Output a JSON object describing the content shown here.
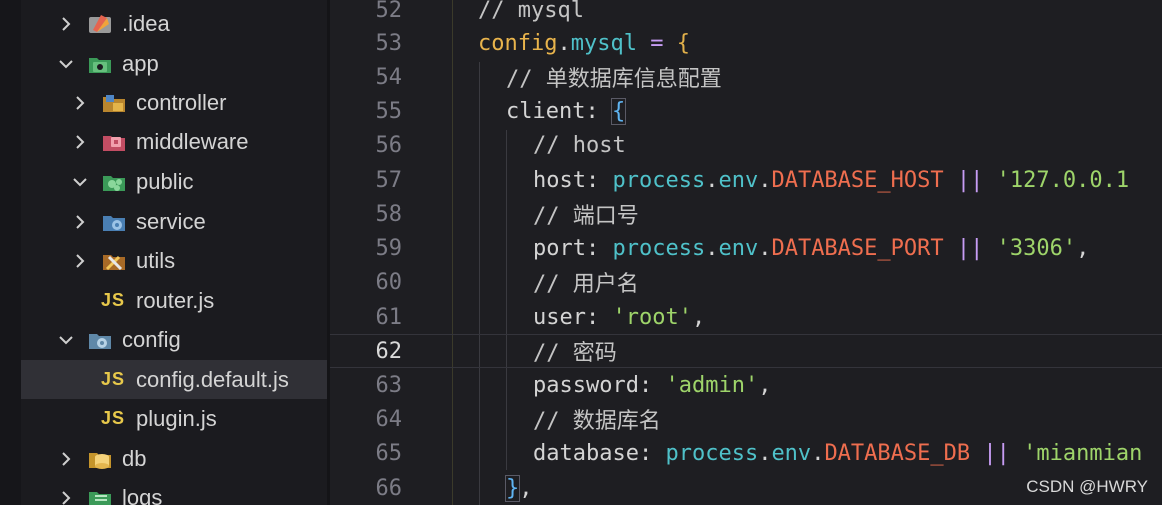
{
  "explorer": {
    "items": [
      {
        "label": ".idea",
        "chevron": "right",
        "icon": "idea-folder-icon",
        "depth": 0
      },
      {
        "label": "app",
        "chevron": "down",
        "icon": "app-folder-icon",
        "depth": 0
      },
      {
        "label": "controller",
        "chevron": "right",
        "icon": "controller-folder-icon",
        "depth": 1
      },
      {
        "label": "middleware",
        "chevron": "right",
        "icon": "middleware-folder-icon",
        "depth": 1
      },
      {
        "label": "public",
        "chevron": "down",
        "icon": "public-folder-icon",
        "depth": 1
      },
      {
        "label": "service",
        "chevron": "right",
        "icon": "service-folder-icon",
        "depth": 1
      },
      {
        "label": "utils",
        "chevron": "right",
        "icon": "utils-folder-icon",
        "depth": 1
      },
      {
        "label": "router.js",
        "chevron": "none",
        "icon": "js-file-icon",
        "depth": 1
      },
      {
        "label": "config",
        "chevron": "down",
        "icon": "config-folder-icon",
        "depth": 0
      },
      {
        "label": "config.default.js",
        "chevron": "none",
        "icon": "js-file-icon",
        "depth": 1,
        "selected": true
      },
      {
        "label": "plugin.js",
        "chevron": "none",
        "icon": "js-file-icon",
        "depth": 1
      },
      {
        "label": "db",
        "chevron": "right",
        "icon": "db-folder-icon",
        "depth": 0
      },
      {
        "label": "logs",
        "chevron": "right",
        "icon": "logs-folder-icon",
        "depth": 0
      }
    ],
    "js_badge": "JS"
  },
  "editor": {
    "active_line": "62",
    "lines": [
      {
        "n": "52",
        "text": "// mysql"
      },
      {
        "n": "53",
        "text": "config.mysql = {"
      },
      {
        "n": "54",
        "text": "// 单数据库信息配置"
      },
      {
        "n": "55",
        "text": "client: {"
      },
      {
        "n": "56",
        "text": "// host"
      },
      {
        "n": "57",
        "text": "host: process.env.DATABASE_HOST || '127.0.0.1"
      },
      {
        "n": "58",
        "text": "// 端口号"
      },
      {
        "n": "59",
        "text": "port: process.env.DATABASE_PORT || '3306',"
      },
      {
        "n": "60",
        "text": "// 用户名"
      },
      {
        "n": "61",
        "text": "user: 'root',"
      },
      {
        "n": "62",
        "text": "// 密码"
      },
      {
        "n": "63",
        "text": "password: 'admin',"
      },
      {
        "n": "64",
        "text": "// 数据库名"
      },
      {
        "n": "65",
        "text": "database: process.env.DATABASE_DB || 'mianmian"
      },
      {
        "n": "66",
        "text": "},"
      }
    ],
    "tokens": {
      "l52": [
        "// mysql"
      ],
      "l53": [
        "config",
        ".",
        "mysql",
        " = ",
        "{"
      ],
      "l54": [
        "// 单数据库信息配置"
      ],
      "l55": [
        "client",
        ": ",
        "{"
      ],
      "l56": [
        "// host"
      ],
      "l57": [
        "host",
        ": ",
        "process",
        ".",
        "env",
        ".",
        "DATABASE_HOST",
        " || ",
        "'127.0.0.1"
      ],
      "l58": [
        "// 端口号"
      ],
      "l59": [
        "port",
        ": ",
        "process",
        ".",
        "env",
        ".",
        "DATABASE_PORT",
        " || ",
        "'3306'",
        ","
      ],
      "l60": [
        "// 用户名"
      ],
      "l61": [
        "user",
        ": ",
        "'root'",
        ","
      ],
      "l62": [
        "// 密码"
      ],
      "l63": [
        "password",
        ": ",
        "'admin'",
        ","
      ],
      "l64": [
        "// 数据库名"
      ],
      "l65": [
        "database",
        ": ",
        "process",
        ".",
        "env",
        ".",
        "DATABASE_DB",
        " || ",
        "'mianmian"
      ],
      "l66": [
        "}",
        ","
      ]
    }
  },
  "watermark": "CSDN @HWRY",
  "colors": {
    "comment": "#c4c4c4",
    "variable": "#e9b44c",
    "property": "#4fc1c9",
    "constant": "#ef6e4f",
    "string": "#9ed46a",
    "operator": "#c79cf4"
  }
}
